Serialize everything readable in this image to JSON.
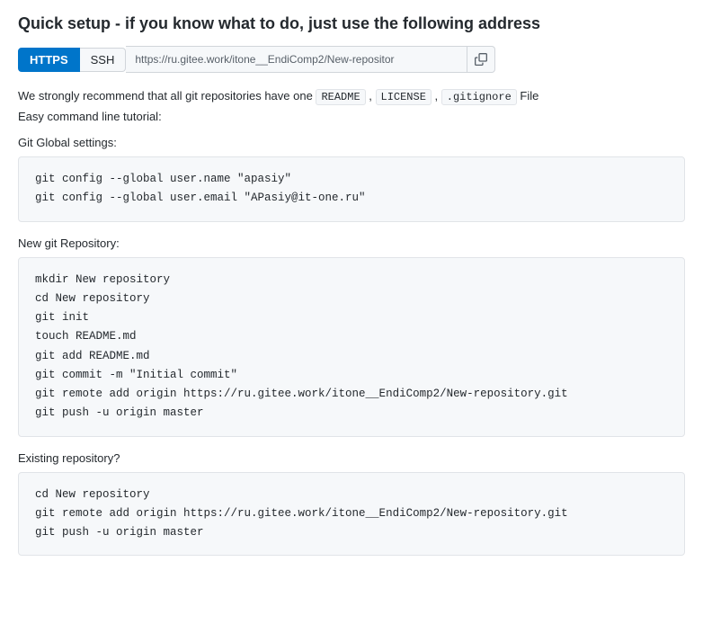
{
  "header": {
    "title": "Quick setup - if you know what to do, just use the following address"
  },
  "url_bar": {
    "btn_https": "HTTPS",
    "btn_ssh": "SSH",
    "url_value": "https://ru.gitee.work/itone__EndiComp2/New-repositor"
  },
  "recommend": {
    "text_before": "We strongly recommend that all git repositories have one ",
    "readme": "README",
    "comma1": " , ",
    "license": "LICENSE",
    "comma2": " , ",
    "gitignore": ".gitignore",
    "text_after": " File"
  },
  "easy_command": "Easy command line tutorial:",
  "global_settings_label": "Git Global settings:",
  "global_settings_code": "git config --global user.name \"apasiy\"\ngit config --global user.email \"APasiy@it-one.ru\"",
  "new_git_label": "New git Repository:",
  "new_git_code": "mkdir New repository\ncd New repository\ngit init\ntouch README.md\ngit add README.md\ngit commit -m \"Initial commit\"\ngit remote add origin https://ru.gitee.work/itone__EndiComp2/New-repository.git\ngit push -u origin master",
  "existing_label": "Existing repository?",
  "existing_code": "cd New repository\ngit remote add origin https://ru.gitee.work/itone__EndiComp2/New-repository.git\ngit push -u origin master"
}
